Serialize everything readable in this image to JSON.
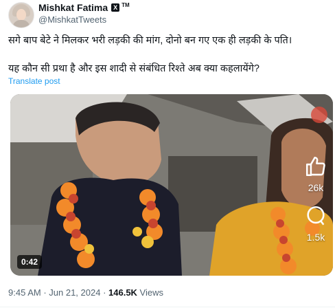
{
  "tweet": {
    "author_name": "Mishkat Fatima",
    "badge_letter": "X",
    "badge_tm": "TM",
    "handle": "@MishkatTweets",
    "text_line1": "सगे बाप बेटे ने मिलकर भरी लड़की की मांग, दोनो बन गए एक ही लड़की के पति।",
    "text_line2": "यह कौन सी प्रथा है और इस शादी से संबंधित रिश्ते अब क्या कहलायेंगे?",
    "translate_label": "Translate post"
  },
  "video": {
    "duration": "0:42",
    "likes_count": "26k",
    "comments_count": "1.5k"
  },
  "meta": {
    "time": "9:45 AM",
    "separator1": " · ",
    "date": "Jun 21, 2024",
    "separator2": " · ",
    "views_count": "146.5K",
    "views_label": " Views"
  },
  "colors": {
    "accent": "#1d9bf0",
    "text": "#0f1419",
    "secondary": "#536471"
  },
  "icons": [
    "thumbs-up-icon",
    "comment-bubble-icon"
  ]
}
